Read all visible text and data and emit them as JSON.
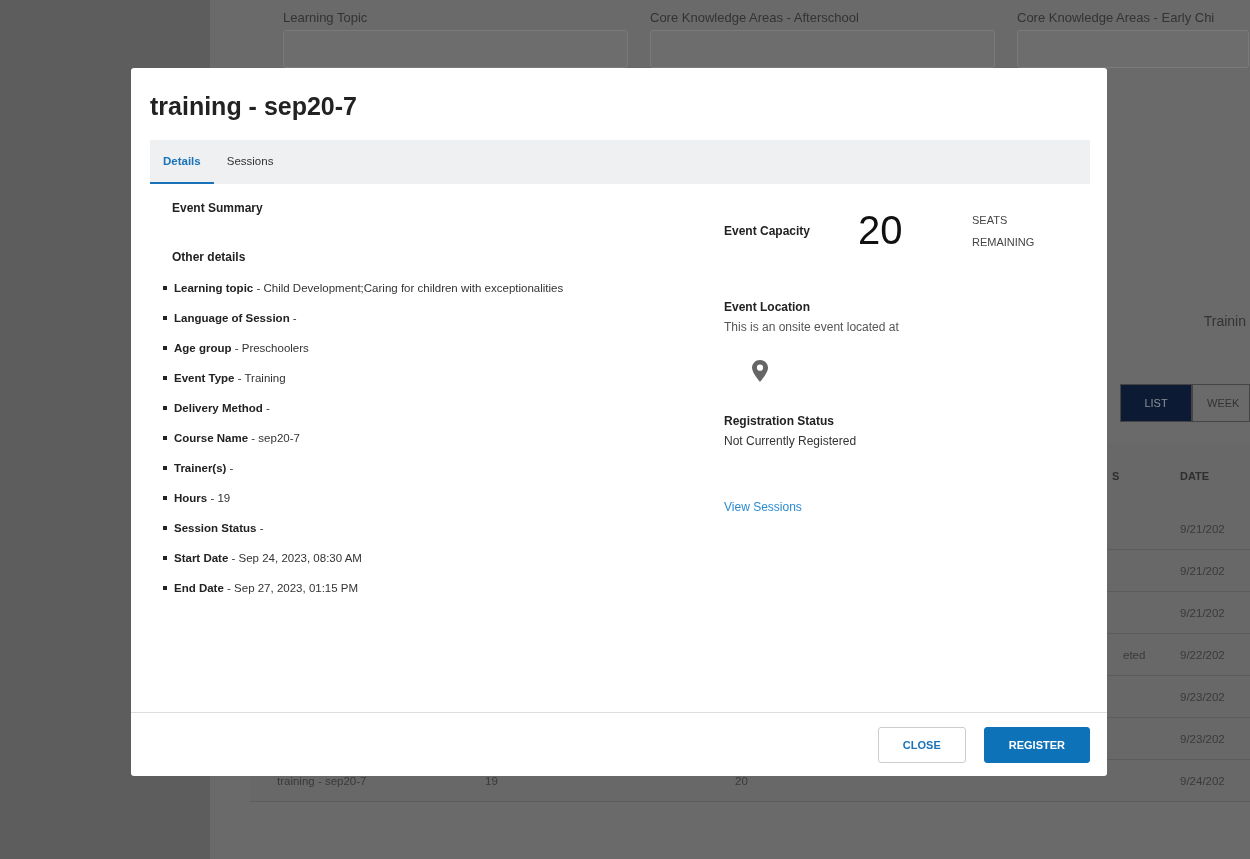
{
  "background": {
    "filters": [
      {
        "label": "Learning Topic"
      },
      {
        "label": "Core Knowledge Areas - Afterschool"
      },
      {
        "label": "Core Knowledge Areas - Early Chi"
      }
    ],
    "section_title": "Trainin",
    "view_toggle": [
      {
        "label": "LIST",
        "selected": true
      },
      {
        "label": "WEEK",
        "selected": false
      }
    ],
    "table": {
      "columns": [
        "S",
        "DATE"
      ],
      "rows": [
        {
          "date": "9/21/202"
        },
        {
          "date": "9/21/202"
        },
        {
          "date": "9/21/202"
        },
        {
          "column_4": "eted",
          "date": "9/22/202"
        },
        {
          "date": "9/23/202"
        },
        {
          "date": "9/23/202"
        },
        {
          "column_1": "training - sep20-7",
          "column_2": "19",
          "column_3": "20",
          "date": "9/24/202"
        }
      ]
    }
  },
  "dialog": {
    "title": "training - sep20-7",
    "tabs": [
      {
        "label": "Details",
        "selected": true
      },
      {
        "label": "Sessions",
        "selected": false
      }
    ],
    "event_summary_heading": "Event Summary",
    "other_details_heading": "Other details",
    "details": [
      "**Learning topic** - Child Development;Caring for children with exceptionalities",
      "**Language of Session** -",
      "**Age group** - Preschoolers",
      "**Event Type** - Training",
      "**Delivery Method** -",
      "**Course Name** - sep20-7",
      "**Trainer(s)** -",
      "**Hours** - 19",
      "**Session Status** -",
      "**Start Date** - Sep 24, 2023, 08:30 AM",
      "**End Date** - Sep 27, 2023, 01:15 PM"
    ],
    "capacity": {
      "label": "Event Capacity",
      "value": "20",
      "unit": "SEATS REMAINING"
    },
    "location": {
      "heading": "Event Location",
      "text": "This is an onsite event located at"
    },
    "registration": {
      "heading": "Registration Status",
      "status": "Not Currently Registered"
    },
    "link": "View Sessions",
    "buttons": [
      {
        "label": "CLOSE",
        "kind": "secondary"
      },
      {
        "label": "REGISTER",
        "kind": "primary"
      }
    ]
  }
}
